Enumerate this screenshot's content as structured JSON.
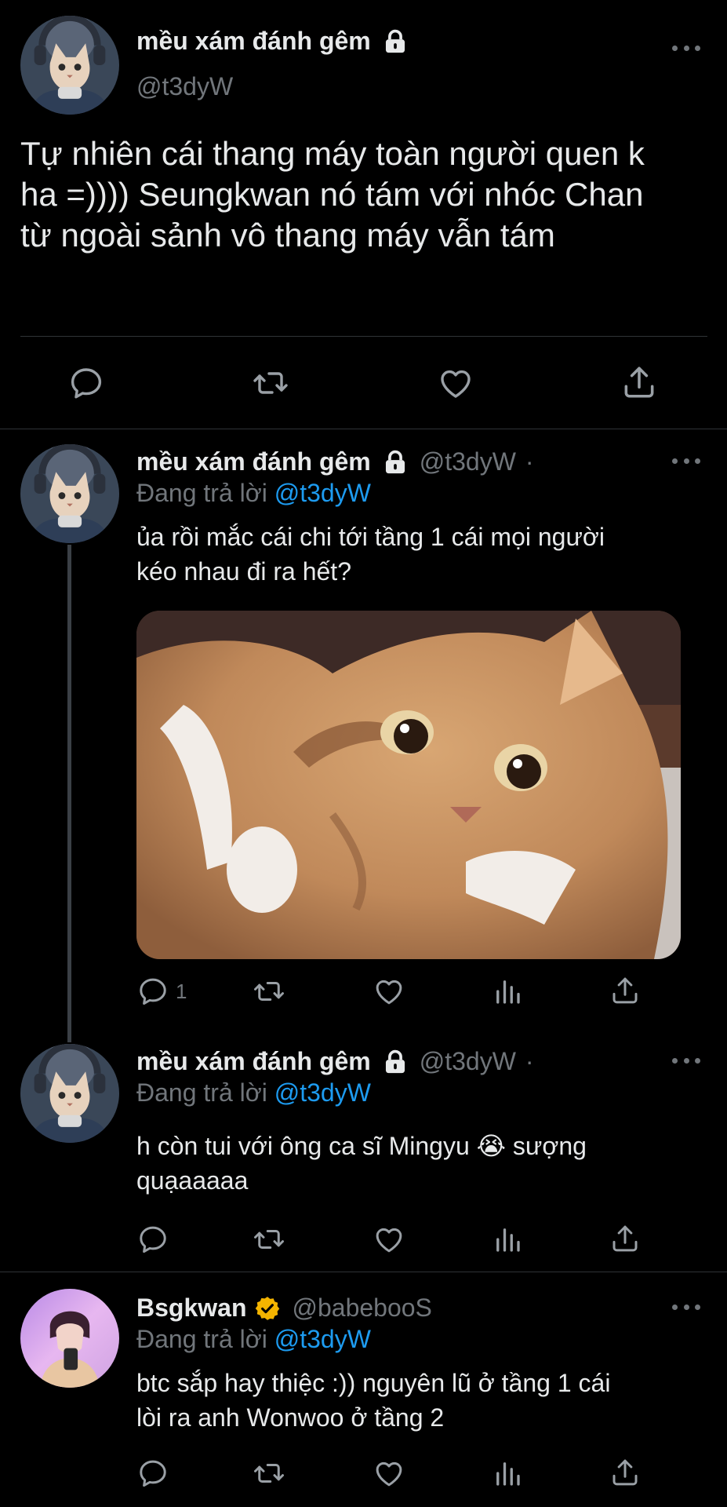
{
  "colors": {
    "background": "#000000",
    "text": "#e7e9ea",
    "muted": "#71767b",
    "link": "#1d9bf0",
    "verified": "#f4b400"
  },
  "main_tweet": {
    "display_name": "mều xám đánh gêm",
    "handle": "@t3dyW",
    "text_lines": [
      "Tự nhiên cái thang máy toàn người quen k",
      "ha =)))) Seungkwan nó tám với nhóc Chan",
      "từ ngoài sảnh vô thang máy vẫn tám"
    ],
    "actions": [
      "reply-icon",
      "retweet-icon",
      "like-icon",
      "share-icon"
    ]
  },
  "replies": [
    {
      "display_name": "mều xám đánh gêm",
      "handle": "@t3dyW",
      "replying_prefix": "Đang trả lời",
      "replying_to": "@t3dyW",
      "text_lines": [
        "ủa rồi mắc cái chi tới tầng 1 cái mọi người",
        "kéo nhau đi ra hết?"
      ],
      "reply_count": "1",
      "media": "crying cat meme"
    },
    {
      "display_name": "mều xám đánh gêm",
      "handle": "@t3dyW",
      "replying_prefix": "Đang trả lời",
      "replying_to": "@t3dyW",
      "text_lines": [
        "h còn tui với ông ca sĩ Mingyu 😭  sượng",
        "quạaaaaa"
      ]
    },
    {
      "display_name": "Bsgkwan",
      "handle": "@babebooS",
      "replying_prefix": "Đang trả lời",
      "replying_to": "@t3dyW",
      "text_lines": [
        "btc sắp hay thiệc :)) nguyên lũ ở tầng 1 cái",
        "lòi ra anh Wonwoo ở tầng 2"
      ]
    }
  ]
}
